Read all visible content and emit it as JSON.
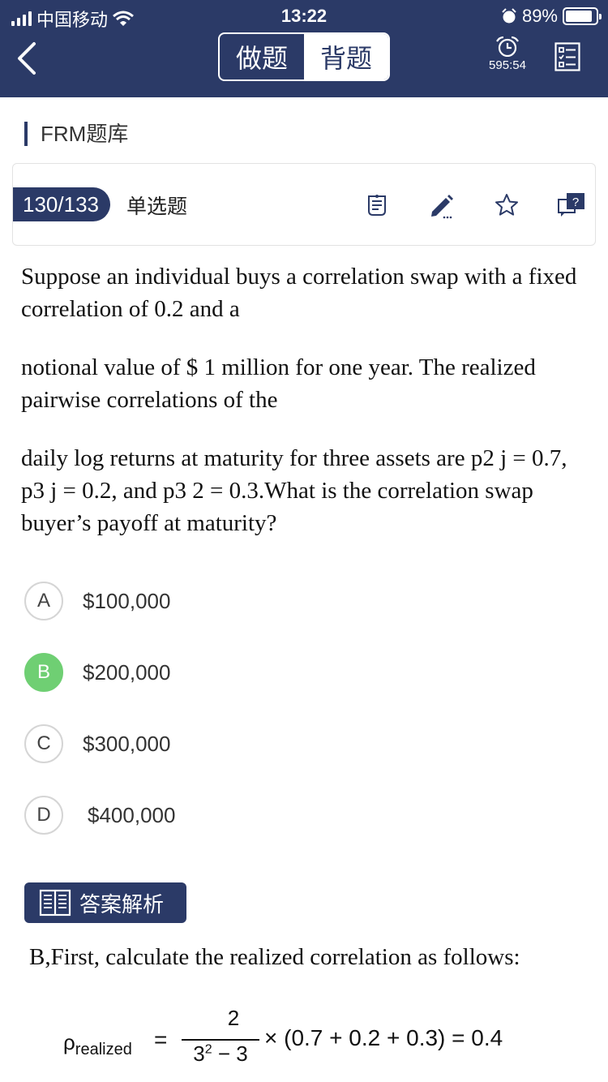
{
  "status_bar": {
    "carrier": "中国移动",
    "time": "13:22",
    "battery": "89%",
    "battery_level": 0.89
  },
  "nav": {
    "mode_tabs": [
      "做题",
      "背题"
    ],
    "active_tab": "背题",
    "timer": "595:54"
  },
  "subject": "FRM题库",
  "question": {
    "index": "130/133",
    "type": "单选题",
    "paragraphs": [
      "Suppose an individual buys a correlation swap with a fixed correlation of 0.2 and a",
      "notional value of $ 1 million for one year. The realized pairwise correlations of the",
      "daily log returns at maturity for three assets are p2 j = 0.7, p3 j = 0.2, and p3 2 = 0.3.What is the correlation swap buyer’s payoff at maturity?"
    ]
  },
  "options": [
    {
      "letter": "A",
      "text": "$100,000"
    },
    {
      "letter": "B",
      "text": "$200,000",
      "correct": true
    },
    {
      "letter": "C",
      "text": "$300,000"
    },
    {
      "letter": "D",
      "text": "$400,000"
    }
  ],
  "analysis": {
    "button_label": "答案解析",
    "text": "B,First, calculate the realized correlation as follows:",
    "formula": {
      "lhs": "ρ",
      "lhs_sub": "realized",
      "eq": "=",
      "numerator": "2",
      "denominator_base": "3",
      "denominator_exp": "2",
      "denominator_tail": " − 3",
      "rest": "× (0.7 + 0.2 + 0.3) = 0.4"
    }
  },
  "colors": {
    "primary": "#2b3a67",
    "correct": "#6fcf73"
  }
}
